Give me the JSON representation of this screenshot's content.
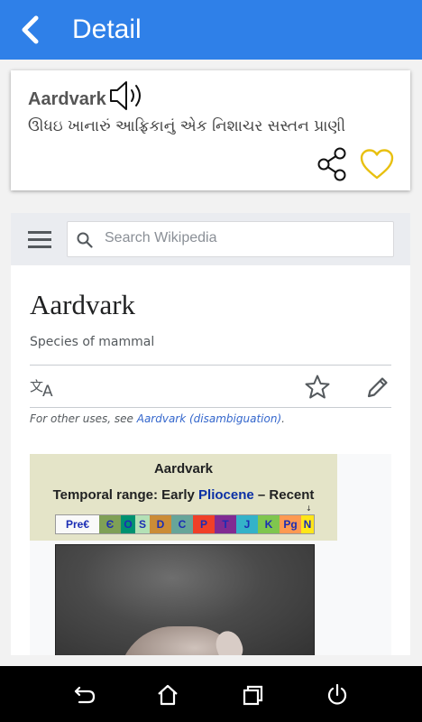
{
  "app_bar": {
    "title": "Detail",
    "back_icon": "arrow-back-icon",
    "background": "#2f80e8"
  },
  "entry": {
    "word": "Aardvark",
    "meaning": "ઊધઇ ખાનારું આફ્રિકાનું એક નિશાચર સસ્તન પ્રાણી",
    "speaker_icon": "speaker-icon",
    "share_icon": "share-icon",
    "favorite_icon": "heart-outline-icon",
    "favorite_color": "#e8c010"
  },
  "wikipedia": {
    "menu_icon": "hamburger-icon",
    "search_placeholder": "Search Wikipedia",
    "page_title": "Aardvark",
    "description": "Species of mammal",
    "language_icon": "translate-icon",
    "watch_icon": "star-outline-icon",
    "edit_icon": "pencil-icon",
    "hatnote_prefix": "For other uses, see ",
    "hatnote_link": "Aardvark (disambiguation)",
    "hatnote_suffix": ".",
    "link_color": "#3366cc",
    "infobox": {
      "title": "Aardvark",
      "range_prefix": "Temporal range: Early ",
      "range_link": "Pliocene",
      "range_suffix": " – Recent",
      "marker": "↓",
      "periods": [
        {
          "label": "Pre€",
          "color": "#f9f9f9"
        },
        {
          "label": "Є",
          "color": "#7fa056"
        },
        {
          "label": "O",
          "color": "#009270"
        },
        {
          "label": "S",
          "color": "#b3e1b6"
        },
        {
          "label": "D",
          "color": "#cb8c37"
        },
        {
          "label": "C",
          "color": "#67a599"
        },
        {
          "label": "P",
          "color": "#f04028"
        },
        {
          "label": "T",
          "color": "#812b92"
        },
        {
          "label": "J",
          "color": "#34b2c9"
        },
        {
          "label": "K",
          "color": "#7fc64e"
        },
        {
          "label": "Pg",
          "color": "#fd9a52"
        },
        {
          "label": "N",
          "color": "#ffe619"
        }
      ]
    }
  },
  "system_nav": {
    "back": "nav-back-icon",
    "home": "nav-home-icon",
    "recents": "nav-recents-icon",
    "power": "power-icon"
  }
}
